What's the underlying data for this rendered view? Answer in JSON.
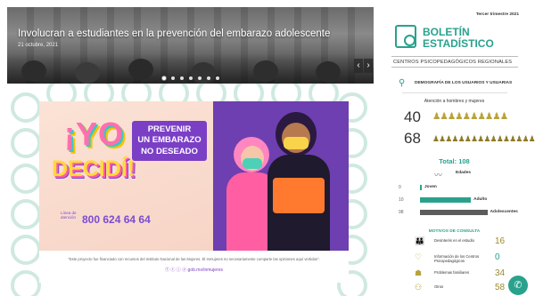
{
  "slider": {
    "title": "Involucran a estudiantes en la prevención del embarazo adolescente",
    "date": "21 octubre, 2021",
    "dots": 7,
    "active_dot": 0,
    "prev_icon": "chevron-left-icon",
    "next_icon": "chevron-right-icon"
  },
  "poster": {
    "yo": "¡YO",
    "decidi": "DECIDÍ!",
    "line_label": "Línea de atención",
    "phone": "800 624 64 64",
    "prevenir": [
      "PREVENIR",
      "UN EMBARAZO",
      "NO DESEADO"
    ],
    "footer_text": "\"Este proyecto fue financiado con recursos del Instituto Nacional de las Mujeres. El Inmujeres no necesariamente comparte las opiniones aquí vertidas\".",
    "social_text": "ⓕ ⓣ ⓘ ⓨ  gob.mx/inmujeres"
  },
  "sidebar": {
    "period": "Tercer trimestre 2021",
    "logo_icon": "magnifier-document-icon",
    "title_line1": "BOLETÍN",
    "title_line2": "ESTADÍSTICO",
    "subtitle": "CENTROS PSICOPEDAGÓGICOS REGIONALES",
    "user_icon": "user-outline-icon",
    "demographics_label": "DEMOGRAFÍA DE LOS USUARIOS Y USUARIAS",
    "attention_label": "Atención a hombres y mujeres",
    "men_count": "40",
    "women_count": "68",
    "men_icons": "♟♟♟♟♟♟♟♟♟♟",
    "women_icons": "♟♟♟♟♟♟♟♟♟♟♟♟♟♟♟♟♟",
    "total_label": "Total: 108",
    "ages_icon": "line-trend-icon",
    "ages_label": "Edades",
    "age_bars": [
      {
        "value": "0",
        "label": "Joven",
        "fill": 0.02,
        "dark": false
      },
      {
        "value": "10",
        "label": "Adulto",
        "fill": 0.68,
        "dark": false
      },
      {
        "value": "98",
        "label": "Adolescentes",
        "fill": 0.9,
        "dark": true
      }
    ],
    "motivos_label": "MOTIVOS DE CONSULTA",
    "motivos": [
      {
        "icon": "group-icon",
        "label": "Desinterés en el estudio",
        "value": "16",
        "teal": false
      },
      {
        "icon": "heart-hand-icon",
        "label": "Información de los Centros Psicopedagógicos",
        "value": "0",
        "teal": true
      },
      {
        "icon": "family-icon",
        "label": "Problemas familiares",
        "value": "34",
        "teal": false
      },
      {
        "icon": "people-icon",
        "label": "Otros",
        "value": "58",
        "teal": false
      }
    ],
    "chat_icon": "chat-widget-icon"
  }
}
